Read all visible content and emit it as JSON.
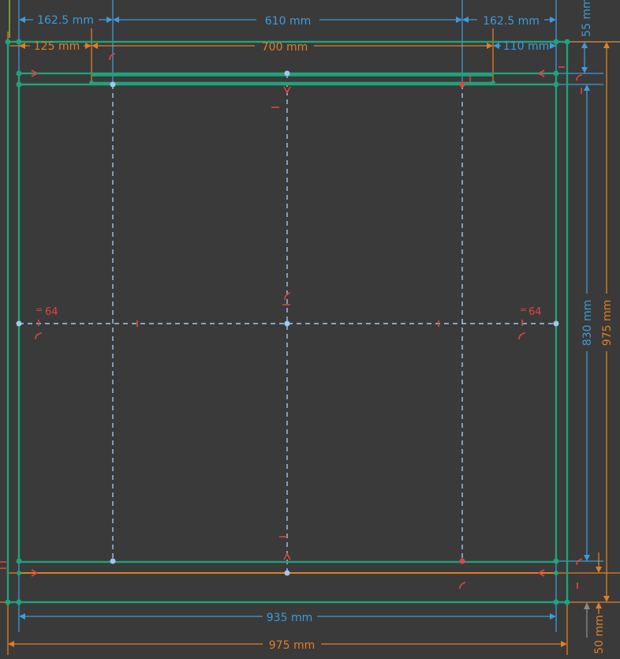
{
  "colors": {
    "background": "#3a3a3a",
    "geometry": "#1ea37a",
    "dimension_blue": "#3d9bdb",
    "dimension_orange": "#e07f24",
    "construction": "#9ec9f0",
    "constraint_red": "#e04444",
    "vertex_point": "#1ea37a",
    "selected_point": "#e04444"
  },
  "dimensions": {
    "top_left_offset": "162.5 mm",
    "top_center_span": "610 mm",
    "top_right_offset": "162.5 mm",
    "top_height": "55 mm",
    "inner_left_offset": "125 mm",
    "inner_span": "700 mm",
    "inner_right_offset": "110 mm",
    "inner_height": "830 mm",
    "outer_height": "975 mm",
    "bottom_inner_width": "935 mm",
    "bottom_outer_width": "975 mm",
    "bottom_offset": "50 mm"
  },
  "constraints": {
    "left_equal_value": "64",
    "right_equal_value": "64",
    "equal_symbol": "="
  },
  "icons": {
    "arrow_marker": "arrow-right-icon",
    "tangent_marker": "tangent-constraint-icon",
    "coincident_marker": "coincident-constraint-icon"
  }
}
